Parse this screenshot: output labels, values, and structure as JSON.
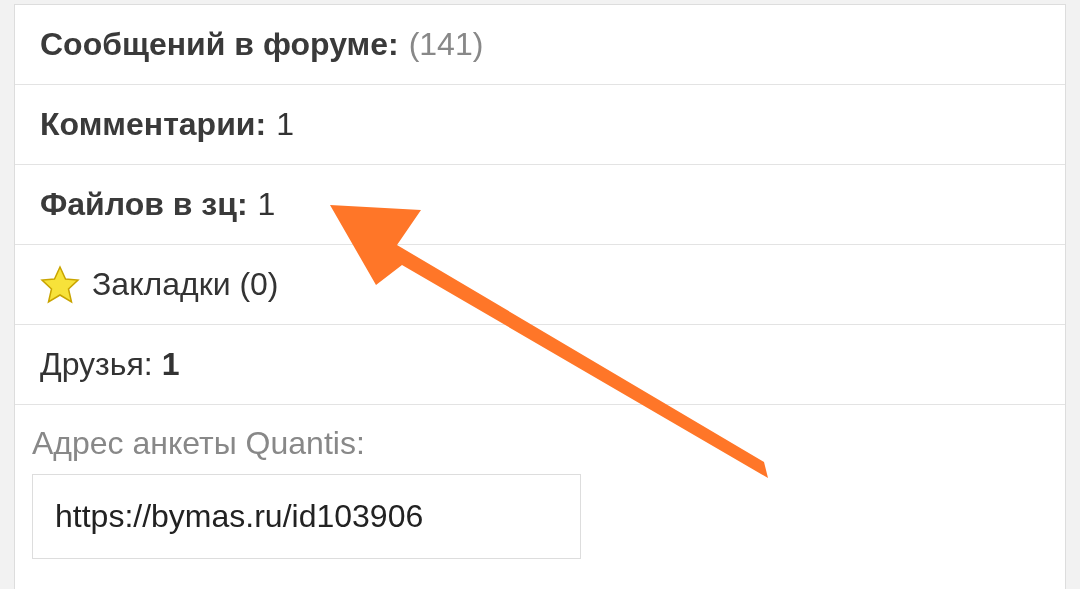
{
  "rows": [
    {
      "kind": "stat",
      "label": "Сообщений в форуме:",
      "value": "(141)",
      "dimmed": true
    },
    {
      "kind": "stat",
      "label": "Комментарии:",
      "value": "1",
      "dimmed": false
    },
    {
      "kind": "stat",
      "label": "Файлов в зц:",
      "value": "1",
      "dimmed": false
    },
    {
      "kind": "bookmark",
      "text": "Закладки (0)"
    },
    {
      "kind": "friends",
      "text": "Друзья: **1**"
    }
  ],
  "profile_address": {
    "label": "Адрес анкеты Quantis:",
    "value": "https://bymas.ru/id103906"
  },
  "annotation": {
    "kind": "arrow"
  }
}
